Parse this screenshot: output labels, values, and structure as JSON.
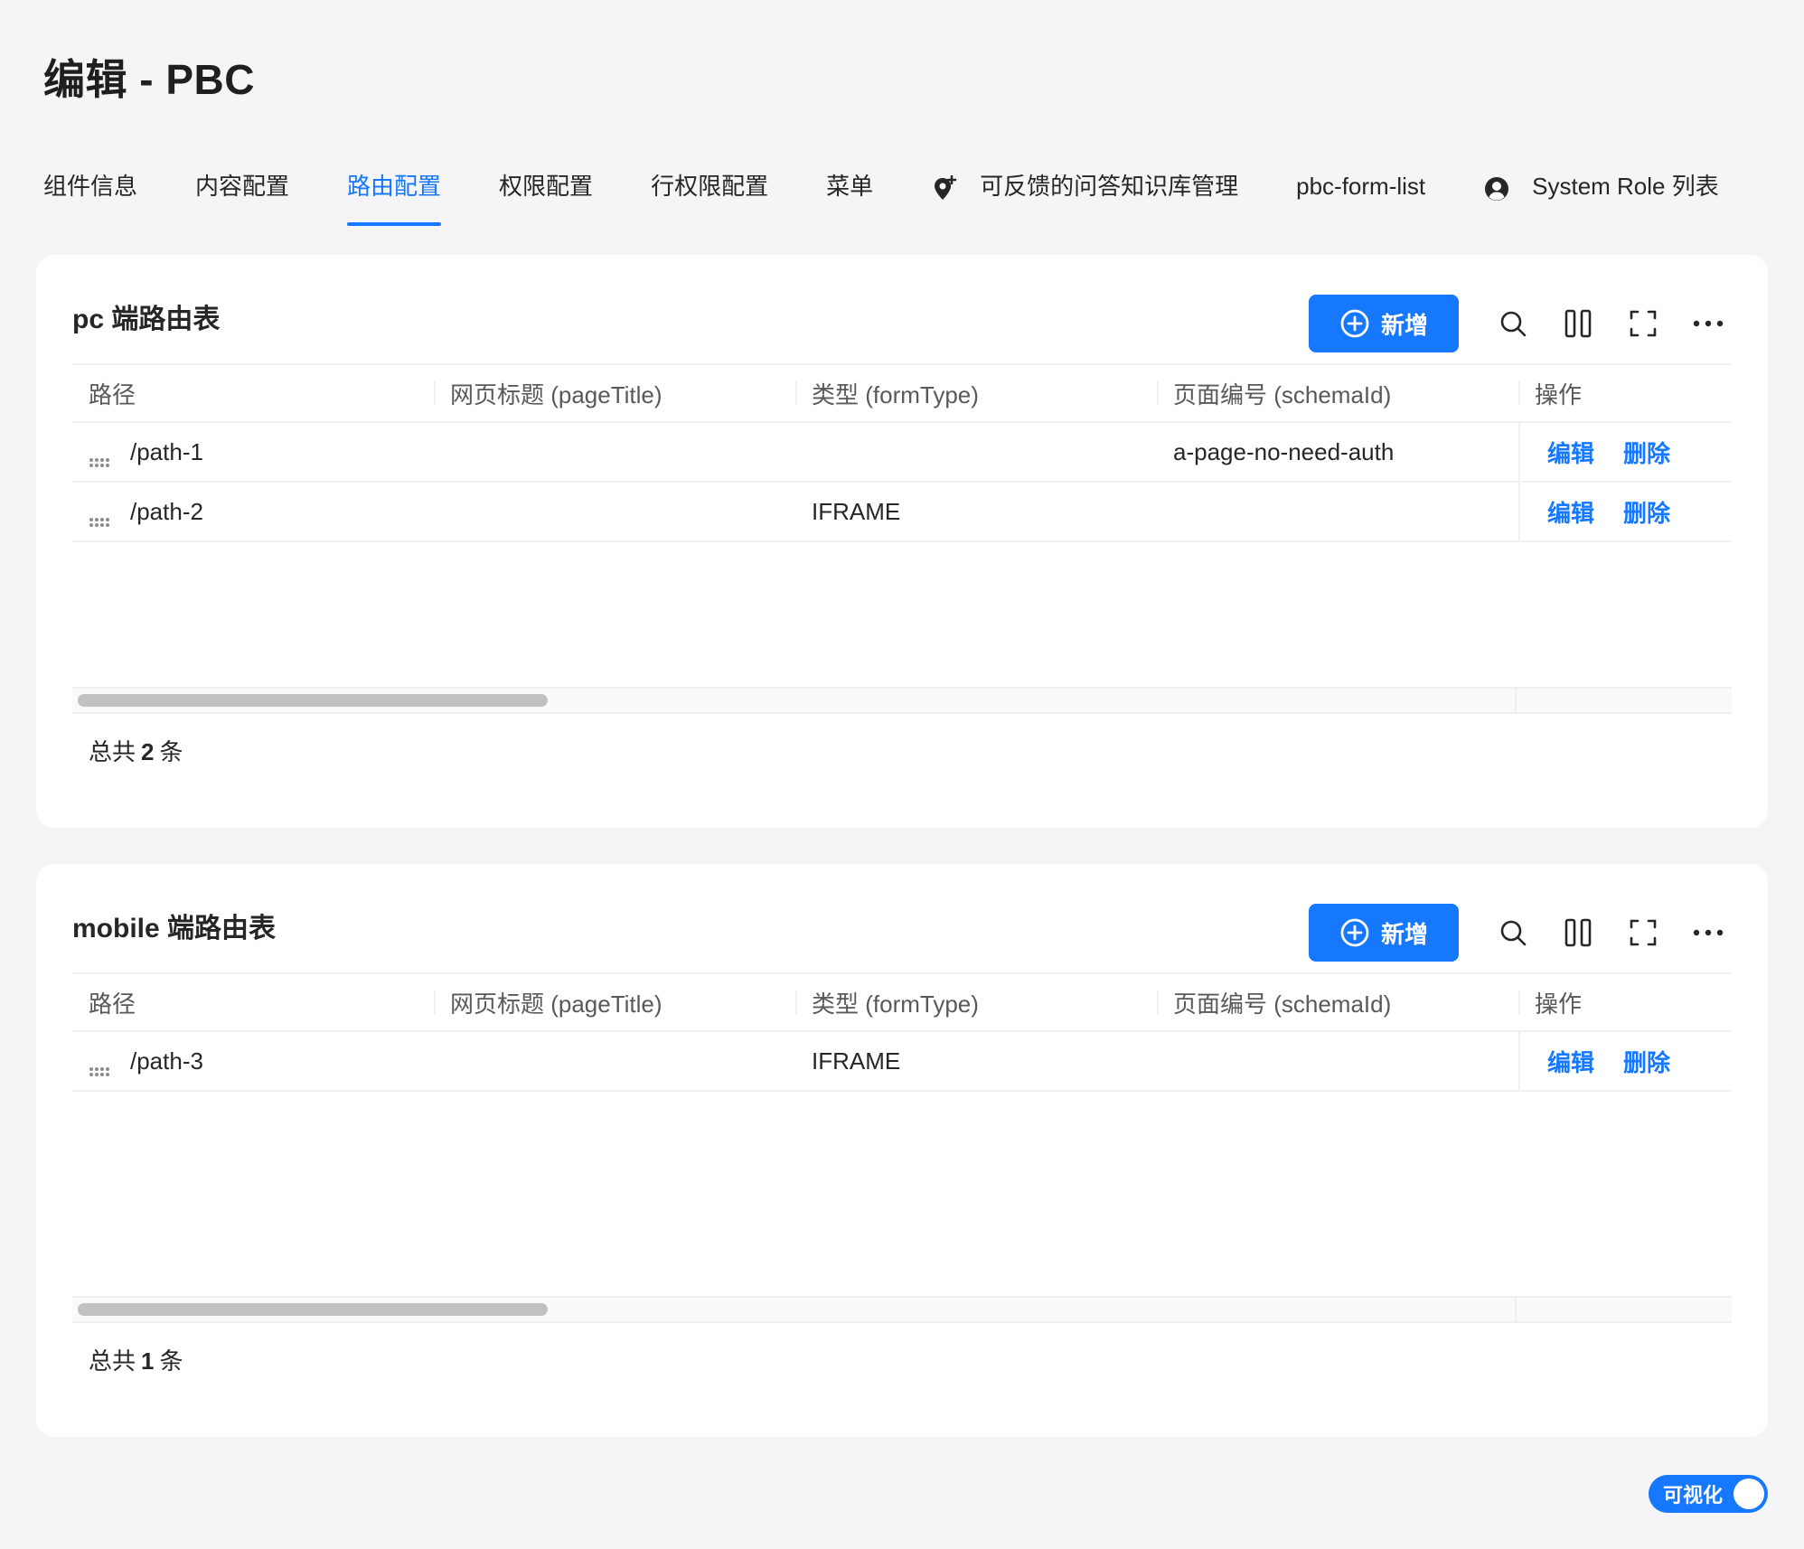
{
  "page": {
    "title": "编辑 - PBC"
  },
  "tabs": [
    {
      "label": "组件信息",
      "active": false,
      "icon": null
    },
    {
      "label": "内容配置",
      "active": false,
      "icon": null
    },
    {
      "label": "路由配置",
      "active": true,
      "icon": null
    },
    {
      "label": "权限配置",
      "active": false,
      "icon": null
    },
    {
      "label": "行权限配置",
      "active": false,
      "icon": null
    },
    {
      "label": "菜单",
      "active": false,
      "icon": null
    },
    {
      "label": "可反馈的问答知识库管理",
      "active": false,
      "icon": "location-pin-plus-icon"
    },
    {
      "label": "pbc-form-list",
      "active": false,
      "icon": null
    },
    {
      "label": "System Role 列表",
      "active": false,
      "icon": "user-circle-icon"
    }
  ],
  "pc_table": {
    "title": "pc 端路由表",
    "add_label": "新增",
    "columns": [
      "路径",
      "网页标题 (pageTitle)",
      "类型 (formType)",
      "页面编号 (schemaId)",
      "操作"
    ],
    "rows": [
      {
        "path": "/path-1",
        "pageTitle": "",
        "formType": "",
        "schemaId": "a-page-no-need-auth",
        "edit": "编辑",
        "delete": "删除"
      },
      {
        "path": "/path-2",
        "pageTitle": "",
        "formType": "IFRAME",
        "schemaId": "",
        "edit": "编辑",
        "delete": "删除"
      }
    ],
    "total_prefix": "总共",
    "total_count": "2",
    "total_suffix": "条"
  },
  "mobile_table": {
    "title": "mobile 端路由表",
    "add_label": "新增",
    "columns": [
      "路径",
      "网页标题 (pageTitle)",
      "类型 (formType)",
      "页面编号 (schemaId)",
      "操作"
    ],
    "rows": [
      {
        "path": "/path-3",
        "pageTitle": "",
        "formType": "IFRAME",
        "schemaId": "",
        "edit": "编辑",
        "delete": "删除"
      }
    ],
    "total_prefix": "总共",
    "total_count": "1",
    "total_suffix": "条"
  },
  "toggle": {
    "label": "可视化",
    "on": true
  },
  "colors": {
    "accent": "#1677ff",
    "background": "#f5f5f7",
    "card": "#ffffff"
  }
}
